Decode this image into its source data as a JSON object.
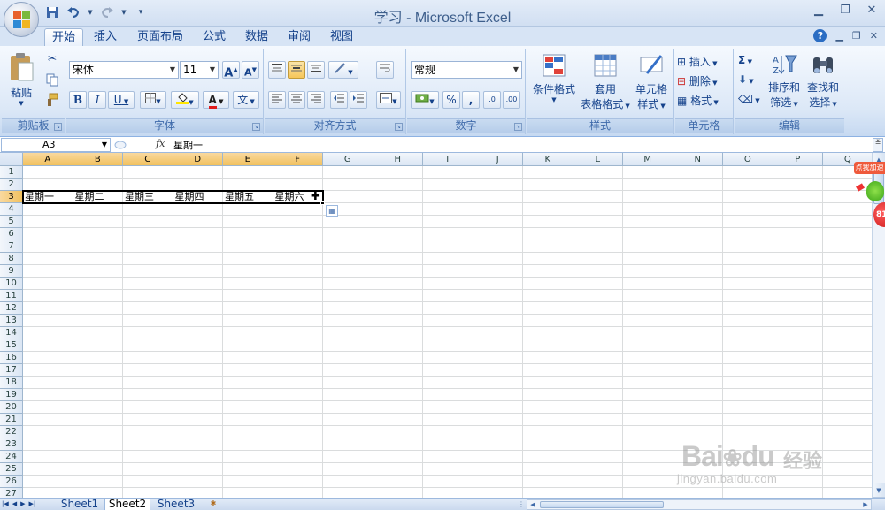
{
  "window": {
    "title": "学习 - Microsoft Excel"
  },
  "qat": {
    "save_icon": "save-icon",
    "undo_icon": "undo-icon",
    "redo_icon": "redo-icon",
    "customize_icon": "customize-icon"
  },
  "tabs": [
    {
      "label": "开始",
      "active": true
    },
    {
      "label": "插入"
    },
    {
      "label": "页面布局"
    },
    {
      "label": "公式"
    },
    {
      "label": "数据"
    },
    {
      "label": "审阅"
    },
    {
      "label": "视图"
    }
  ],
  "ribbon": {
    "clipboard": {
      "label": "剪贴板",
      "paste": "粘贴"
    },
    "font": {
      "label": "字体",
      "name": "宋体",
      "size": "11",
      "bold": "B",
      "italic": "I",
      "underline": "U",
      "grow": "A",
      "shrink": "A",
      "font_color": "A",
      "phonetic": "文"
    },
    "alignment": {
      "label": "对齐方式"
    },
    "number": {
      "label": "数字",
      "format": "常规",
      "percent": "%",
      "comma": ",",
      "inc_decimal": ".0",
      "dec_decimal": ".00"
    },
    "styles": {
      "label": "样式",
      "conditional_l1": "条件格式",
      "table_l1": "套用",
      "table_l2": "表格格式",
      "cell_l1": "单元格",
      "cell_l2": "样式"
    },
    "cells": {
      "label": "单元格",
      "insert": "插入",
      "delete": "删除",
      "format": "格式"
    },
    "editing": {
      "label": "编辑",
      "sum": "Σ",
      "sort_l1": "排序和",
      "sort_l2": "筛选",
      "find_l1": "查找和",
      "find_l2": "选择"
    }
  },
  "formula_bar": {
    "name_box": "A3",
    "fx": "fx",
    "content": "星期一"
  },
  "grid": {
    "columns": [
      "A",
      "B",
      "C",
      "D",
      "E",
      "F",
      "G",
      "H",
      "I",
      "J",
      "K",
      "L",
      "M",
      "N",
      "O",
      "P",
      "Q"
    ],
    "selected_columns": [
      "A",
      "B",
      "C",
      "D",
      "E",
      "F"
    ],
    "rows": [
      "1",
      "2",
      "3",
      "4",
      "5",
      "6",
      "7",
      "8",
      "9",
      "10",
      "11",
      "12",
      "13",
      "14",
      "15",
      "16",
      "17",
      "18",
      "19",
      "20",
      "21",
      "22",
      "23",
      "24",
      "25",
      "26",
      "27"
    ],
    "selected_row": "3",
    "cells": [
      {
        "ref": "A3",
        "value": "星期一"
      },
      {
        "ref": "B3",
        "value": "星期二"
      },
      {
        "ref": "C3",
        "value": "星期三"
      },
      {
        "ref": "D3",
        "value": "星期四"
      },
      {
        "ref": "E3",
        "value": "星期五"
      },
      {
        "ref": "F3",
        "value": "星期六"
      }
    ]
  },
  "sheets": [
    {
      "label": "Sheet1"
    },
    {
      "label": "Sheet2",
      "active": true
    },
    {
      "label": "Sheet3"
    }
  ],
  "widget": {
    "label": "点我加速",
    "count": "81"
  },
  "watermark": {
    "main": "Bai",
    "main2": "du",
    "cn": "经验",
    "url": "jingyan.baidu.com"
  }
}
